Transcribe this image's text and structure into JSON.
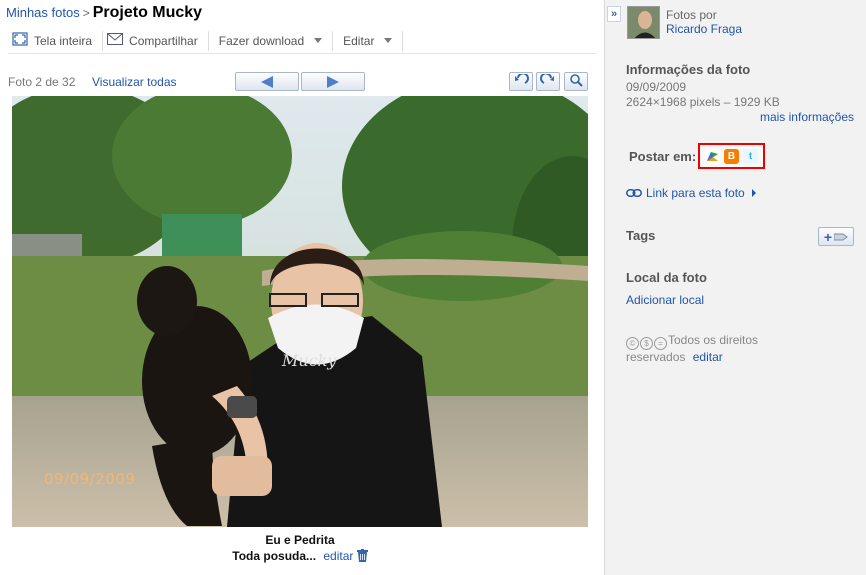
{
  "breadcrumb": {
    "root": "Minhas fotos",
    "separator": ">",
    "album": "Projeto Mucky"
  },
  "toolbar": {
    "fullscreen": "Tela inteira",
    "share": "Compartilhar",
    "download": "Fazer download",
    "edit": "Editar"
  },
  "nav": {
    "counter": "Foto 2 de 32",
    "view_all": "Visualizar todas"
  },
  "photo": {
    "date_stamp": "09/09/2009",
    "shirt_text": "Mucky"
  },
  "caption": {
    "title": "Eu e Pedrita",
    "description": "Toda posuda...",
    "edit": "editar"
  },
  "owner": {
    "by_label": "Fotos por",
    "name": "Ricardo Fraga"
  },
  "info": {
    "title": "Informações da foto",
    "date": "09/09/2009",
    "size": "2624×1968 pixels – 1929 KB",
    "more": "mais informações"
  },
  "post": {
    "label": "Postar em:",
    "services": [
      {
        "icon": "buzz-icon",
        "color": "#2f9e44"
      },
      {
        "icon": "blogger-icon",
        "color": "#f57d00"
      },
      {
        "icon": "twitter-icon",
        "color": "#33b3e6"
      }
    ]
  },
  "link": {
    "label": "Link para esta foto"
  },
  "tags": {
    "title": "Tags"
  },
  "place": {
    "title": "Local da foto",
    "add": "Adicionar local"
  },
  "rights": {
    "text": "Todos os direitos reservados",
    "edit": "editar"
  },
  "colors": {
    "link": "#2255aa",
    "sidebar_bg": "#f2f2f2",
    "highlight_border": "#ee0000"
  }
}
